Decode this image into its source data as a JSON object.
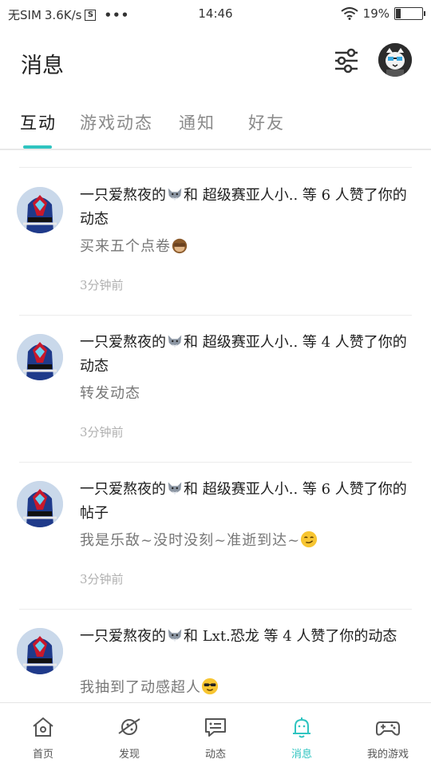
{
  "status_bar": {
    "carrier": "无SIM",
    "speed": "3.6K/s",
    "sim_badge": "S",
    "dots": "•••",
    "time": "14:46",
    "battery": "19%",
    "battery_level": 0.19
  },
  "header": {
    "title": "消息",
    "filter_icon": "sliders-icon",
    "avatar_icon": "user-avatar-cat"
  },
  "tabs": [
    {
      "label": "互动",
      "active": true
    },
    {
      "label": "游戏动态",
      "active": false
    },
    {
      "label": "通知",
      "active": false
    },
    {
      "label": "好友",
      "active": false
    }
  ],
  "feed": [
    {
      "headline_a": "一只爱熬夜的",
      "headline_b": "和 超级赛亚人小.. 等 6 人赞了你的动态",
      "body": "买来五个点卷",
      "body_emoji": "monkey-see-no-evil",
      "time": "3分钟前"
    },
    {
      "headline_a": "一只爱熬夜的",
      "headline_b": "和 超级赛亚人小.. 等 4 人赞了你的动态",
      "body": "转发动态",
      "body_emoji": "",
      "time": "3分钟前"
    },
    {
      "headline_a": "一只爱熬夜的",
      "headline_b": "和 超级赛亚人小.. 等 6 人赞了你的帖子",
      "body": "我是乐敌~没时没刻~准逝到达~",
      "body_emoji": "smirk-face",
      "time": "3分钟前"
    },
    {
      "headline_a": "一只爱熬夜的",
      "headline_b": "和 Lxt.恐龙 等 4 人赞了你的动态",
      "body": "我抽到了动感超人",
      "body_emoji": "sunglasses-face",
      "time": ""
    }
  ],
  "bottom_nav": [
    {
      "label": "首页",
      "icon": "home-icon",
      "active": false
    },
    {
      "label": "发现",
      "icon": "planet-icon",
      "active": false
    },
    {
      "label": "动态",
      "icon": "chat-bubble-icon",
      "active": false
    },
    {
      "label": "消息",
      "icon": "bell-icon",
      "active": true
    },
    {
      "label": "我的游戏",
      "icon": "gamepad-icon",
      "active": false
    }
  ],
  "colors": {
    "accent": "#2fc4c0",
    "text_primary": "#1e1e1e",
    "text_secondary": "#777777",
    "text_muted": "#b0b0b0"
  }
}
